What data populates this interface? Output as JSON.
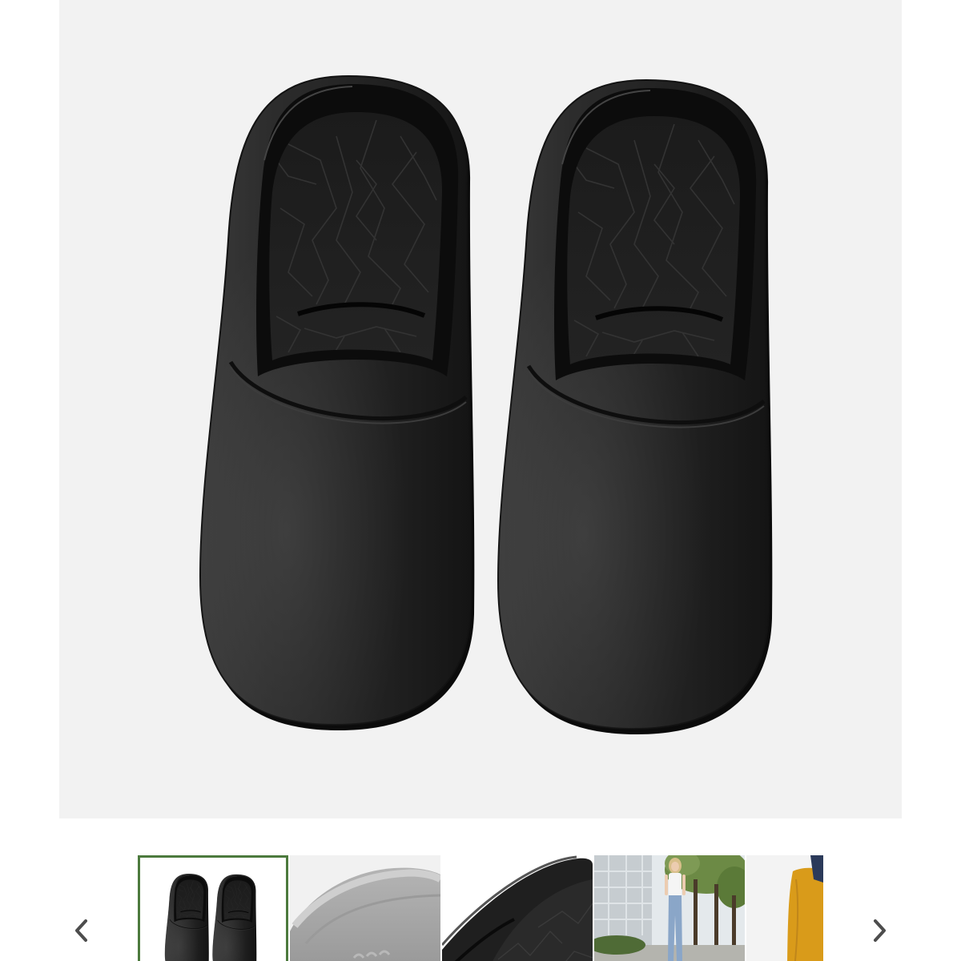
{
  "gallery": {
    "colors": {
      "page_background": "#ffffff",
      "image_background": "#f2f2f2",
      "selected_border": "#4c7a3d",
      "arrow": "#4d4d4d"
    },
    "icons": {
      "prev": "chevron-left-icon",
      "next": "chevron-right-icon"
    },
    "thumbnails": [
      {
        "selected": true
      },
      {
        "selected": false
      },
      {
        "selected": false
      },
      {
        "selected": false
      },
      {
        "selected": false
      }
    ]
  }
}
